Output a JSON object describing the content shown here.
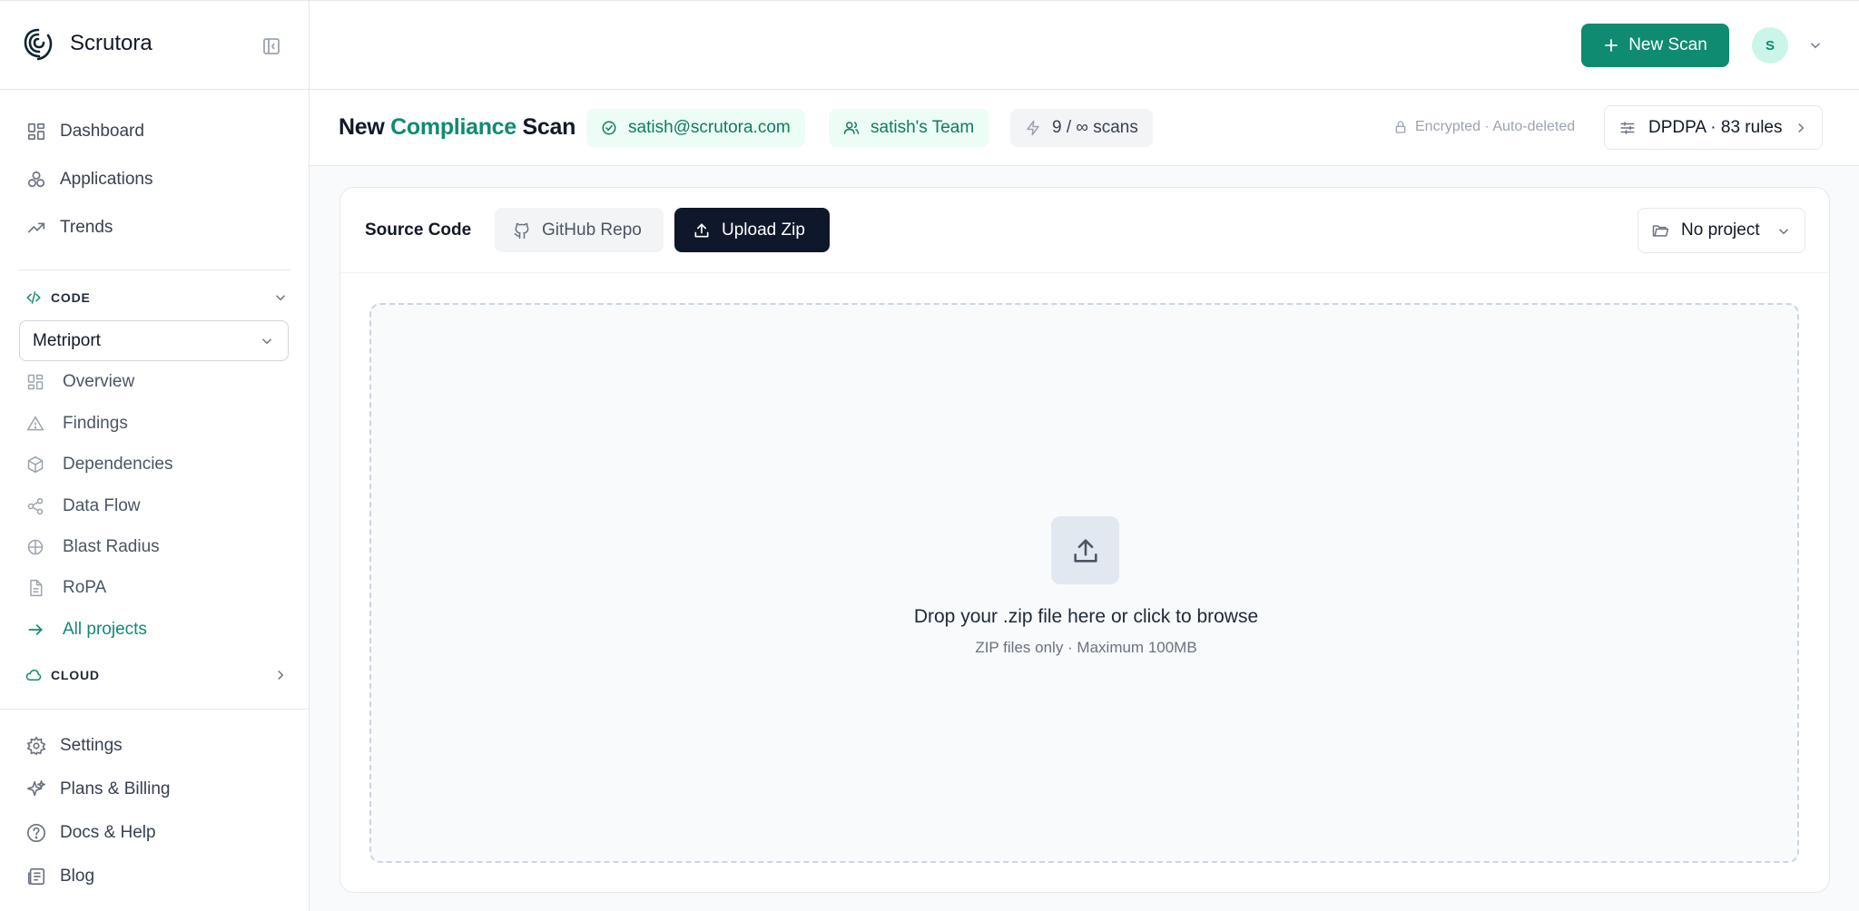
{
  "brand": {
    "name": "Scrutora"
  },
  "nav": {
    "primary": [
      {
        "label": "Dashboard",
        "icon": "dashboard-icon"
      },
      {
        "label": "Applications",
        "icon": "applications-icon"
      },
      {
        "label": "Trends",
        "icon": "trends-icon"
      }
    ],
    "code_section": {
      "label": "CODE",
      "project": "Metriport"
    },
    "code_items": [
      {
        "label": "Overview",
        "icon": "overview-icon"
      },
      {
        "label": "Findings",
        "icon": "warning-icon"
      },
      {
        "label": "Dependencies",
        "icon": "package-icon"
      },
      {
        "label": "Data Flow",
        "icon": "share-icon"
      },
      {
        "label": "Blast Radius",
        "icon": "crosshair-icon"
      },
      {
        "label": "RoPA",
        "icon": "document-icon"
      },
      {
        "label": "All projects",
        "icon": "arrow-right-icon"
      }
    ],
    "cloud_section": {
      "label": "CLOUD"
    },
    "bottom": [
      {
        "label": "Settings",
        "icon": "gear-icon"
      },
      {
        "label": "Plans & Billing",
        "icon": "sparkles-icon"
      },
      {
        "label": "Docs & Help",
        "icon": "help-icon"
      },
      {
        "label": "Blog",
        "icon": "newspaper-icon"
      }
    ]
  },
  "topbar": {
    "new_scan_label": "New Scan",
    "avatar_initial": "S"
  },
  "header": {
    "title_prefix": "New",
    "title_accent": "Compliance",
    "title_suffix": "Scan",
    "email": "satish@scrutora.com",
    "team": "satish's Team",
    "scans": "9 / ∞ scans",
    "security_note": "Encrypted · Auto-deleted",
    "ruleset": "DPDPA · 83 rules"
  },
  "source": {
    "label": "Source Code",
    "tabs": [
      {
        "label": "GitHub Repo",
        "active": false
      },
      {
        "label": "Upload Zip",
        "active": true
      }
    ],
    "project_select": "No project"
  },
  "dropzone": {
    "title": "Drop your .zip file here or click to browse",
    "subtitle": "ZIP files only · Maximum 100MB"
  },
  "colors": {
    "accent": "#0f8b72",
    "dark": "#0f172a",
    "border": "#e5e7eb"
  }
}
